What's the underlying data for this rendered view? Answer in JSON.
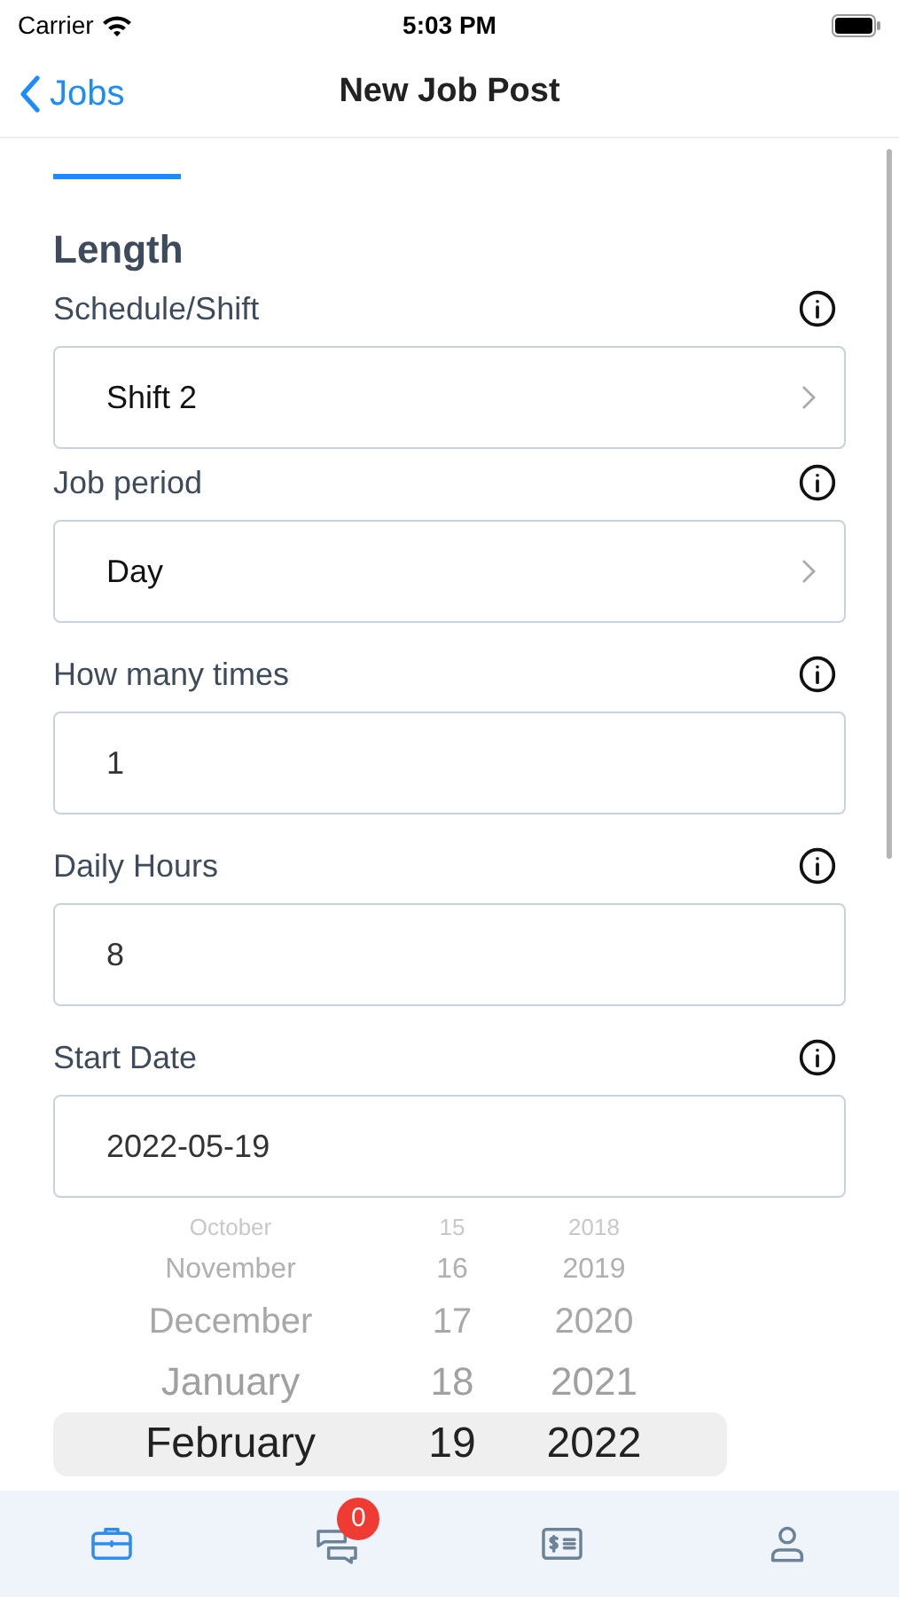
{
  "status_bar": {
    "carrier": "Carrier",
    "time": "5:03 PM"
  },
  "nav": {
    "back": "Jobs",
    "title": "New Job Post"
  },
  "section": {
    "title": "Length"
  },
  "fields": [
    {
      "label": "Schedule/Shift",
      "kind": "select",
      "value": "Shift 2"
    },
    {
      "label": "Job period",
      "kind": "select",
      "value": "Day"
    },
    {
      "label": "How many times",
      "kind": "input",
      "value": "1"
    },
    {
      "label": "Daily Hours",
      "kind": "input",
      "value": "8"
    },
    {
      "label": "Start Date",
      "kind": "input",
      "value": "2022-05-19"
    }
  ],
  "picker": {
    "rows": [
      {
        "month": "October",
        "day": "15",
        "year": "2018",
        "selected": false
      },
      {
        "month": "November",
        "day": "16",
        "year": "2019",
        "selected": false
      },
      {
        "month": "December",
        "day": "17",
        "year": "2020",
        "selected": false
      },
      {
        "month": "January",
        "day": "18",
        "year": "2021",
        "selected": false
      },
      {
        "month": "February",
        "day": "19",
        "year": "2022",
        "selected": true
      }
    ]
  },
  "tab_bar": [
    {
      "kind": "jobs",
      "selected": true
    },
    {
      "kind": "messages",
      "selected": false,
      "badge": "0"
    },
    {
      "kind": "payments",
      "selected": false
    },
    {
      "kind": "profile",
      "selected": false
    }
  ]
}
